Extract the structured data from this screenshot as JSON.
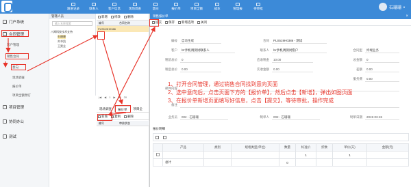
{
  "topbar": {
    "nav": [
      "跟进记录",
      "联系人",
      "客户信息",
      "现场调查",
      "意向",
      "报价单",
      "项目全额",
      "成本",
      "管理报",
      "待审批"
    ],
    "user_name": "石珊珊",
    "caret": "▼",
    "accent": "#3c8ad8"
  },
  "sidebar": {
    "home": "门户系统",
    "contract": "合同管理",
    "customer": "客户管理",
    "sales": "销售合同",
    "intent": "意向",
    "survey": "现场调查",
    "quote": "报价单",
    "fullamount": "项目全额预订",
    "project": "项目管理",
    "office": "协同办公",
    "test": "测试"
  },
  "tree": {
    "header": "管辖人员",
    "search_placeholder": "输入名称搜索",
    "root": "八闽科技技术支持",
    "nodes": [
      "石珊珊",
      "刘书凯",
      "王昊业"
    ]
  },
  "list": {
    "toolbar": [
      "新增",
      "修改",
      "删除"
    ],
    "columns": [
      "编号",
      "合同名称"
    ],
    "selected_row": "PLS519H0386",
    "pager": [
      "|◀",
      "◀",
      "1",
      "▶",
      "▶|",
      "20"
    ],
    "subtabs": [
      "现场调查",
      "报价单",
      "项目全"
    ],
    "sub_toolbar": [
      "新增",
      "复制",
      "删除"
    ],
    "sub_columns": [
      "编号",
      "审核状态"
    ]
  },
  "detail": {
    "window_title": "销售报价单",
    "toolbar": [
      "提交",
      "保存",
      "新增选项",
      "关闭"
    ],
    "fields": [
      {
        "label": "编号",
        "value": "自动生成"
      },
      {
        "label": "合同",
        "value": "PLS519H0386 - 测试"
      },
      {
        "label": "客户",
        "value": "lzr手机调测试联系人"
      },
      {
        "label": "联系人",
        "value": "lzr手机调测试客户"
      },
      {
        "label": "合同型",
        "value": "终端业务"
      },
      {
        "label": "税前总价",
        "value": "0"
      },
      {
        "label": "应收税金",
        "value": "10.00"
      },
      {
        "label": "总金额",
        "value": "0"
      },
      {
        "label": "税后总价",
        "value": "0.00"
      },
      {
        "label": "实收金额",
        "value": "0.00"
      },
      {
        "label": "差额",
        "value": "0.00"
      },
      {
        "label": "服务费",
        "value": "0.00"
      },
      {
        "label": "邮件内容",
        "value": ""
      },
      {
        "label": "备注",
        "value": ""
      },
      {
        "label": "业务员",
        "value": "002 - 石珊珊"
      },
      {
        "label": "制单人",
        "value": "002 - 石珊珊"
      },
      {
        "label": "制单日期",
        "value": "2019-03-26"
      }
    ],
    "items_title": "报价明细",
    "items_columns": [
      "",
      "产品",
      "类别",
      "规格类型(单位)",
      "数量",
      "标准价",
      "折数",
      "单价(天)",
      "金额(元)"
    ],
    "items_row": [
      "",
      "",
      "",
      "",
      "",
      "1",
      "",
      "1",
      ""
    ],
    "items_total": [
      "",
      "总计",
      "",
      "",
      "0",
      "",
      "",
      "",
      ""
    ]
  },
  "instructions": [
    "1、打开合同管理，通过销售合同找到意向页面",
    "2、选中意向后，点击页面下方的【报价单】，然后点击【新增】，弹出如图页面",
    "3、在报价单新增页面填写好信息，点击【提交】，等待审批，操作完成"
  ],
  "annotation_color": "#e8352b"
}
